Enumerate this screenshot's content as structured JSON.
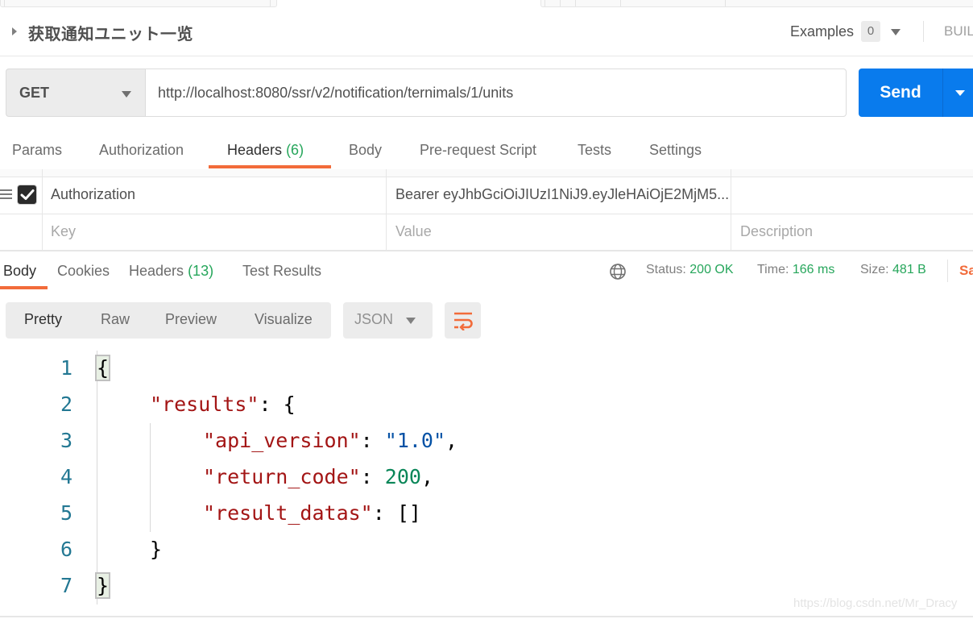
{
  "request": {
    "title": "获取通知ユニット一览",
    "examples_label": "Examples",
    "examples_count": "0",
    "build_label": "BUIL",
    "method": "GET",
    "url": "http://localhost:8080/ssr/v2/notification/ternimals/1/units",
    "send_label": "Send"
  },
  "request_tabs": [
    {
      "label": "Params"
    },
    {
      "label": "Authorization"
    },
    {
      "label": "Headers",
      "count": "(6)",
      "active": true
    },
    {
      "label": "Body"
    },
    {
      "label": "Pre-request Script"
    },
    {
      "label": "Tests"
    },
    {
      "label": "Settings"
    }
  ],
  "headers_table": {
    "rows": [
      {
        "checked": true,
        "key": "Authorization",
        "value": "Bearer eyJhbGciOiJIUzI1NiJ9.eyJleHAiOjE2MjM5...",
        "description": ""
      }
    ],
    "placeholders": {
      "key": "Key",
      "value": "Value",
      "description": "Description"
    }
  },
  "response_tabs": [
    {
      "label": "Body",
      "active": true
    },
    {
      "label": "Cookies"
    },
    {
      "label": "Headers",
      "count": "(13)"
    },
    {
      "label": "Test Results"
    }
  ],
  "response_meta": {
    "status_label": "Status:",
    "status_value": "200 OK",
    "time_label": "Time:",
    "time_value": "166 ms",
    "size_label": "Size:",
    "size_value": "481 B",
    "save_label": "Sa"
  },
  "format_toolbar": {
    "modes": [
      "Pretty",
      "Raw",
      "Preview",
      "Visualize"
    ],
    "active_mode": "Pretty",
    "language": "JSON"
  },
  "code_lines": [
    {
      "num": "1",
      "text": "{"
    },
    {
      "num": "2",
      "key": "\"results\"",
      "rest": ": {"
    },
    {
      "num": "3",
      "key": "\"api_version\"",
      "colon": ": ",
      "value": "\"1.0\"",
      "tail": ","
    },
    {
      "num": "4",
      "key": "\"return_code\"",
      "colon": ": ",
      "value": "200",
      "tail": ","
    },
    {
      "num": "5",
      "key": "\"result_datas\"",
      "rest": ": []"
    },
    {
      "num": "6",
      "text": "}"
    },
    {
      "num": "7",
      "text": "}"
    }
  ],
  "colors": {
    "accent_orange": "#f26b3a",
    "send_blue": "#097bed",
    "status_green": "#26a65b"
  },
  "watermark": "https://blog.csdn.net/Mr_Dracy"
}
